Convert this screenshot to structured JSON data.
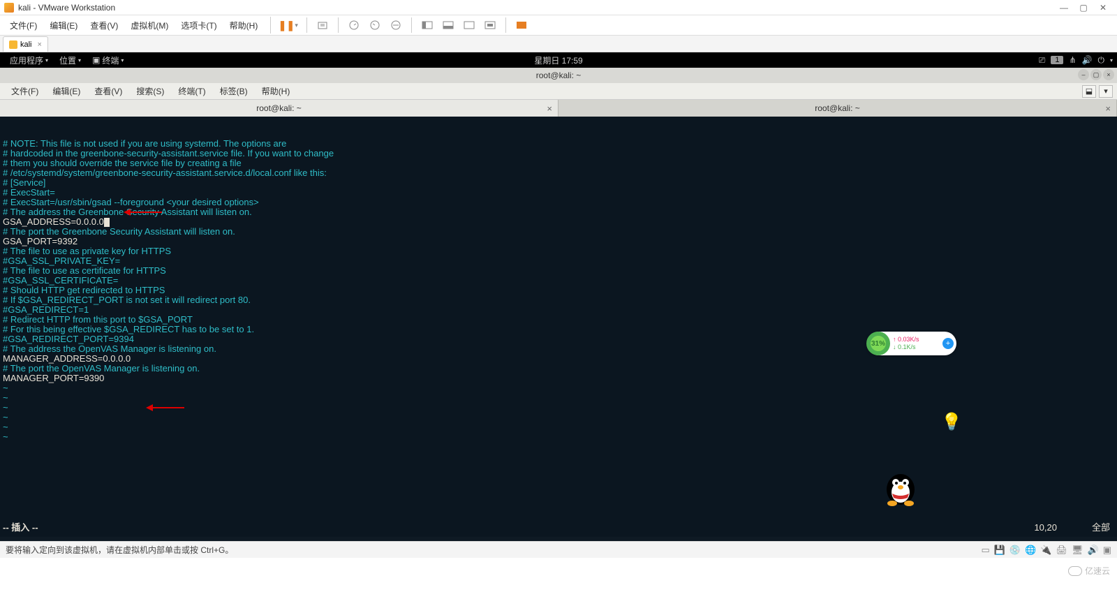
{
  "vmware": {
    "title": "kali - VMware Workstation",
    "menu": [
      "文件(F)",
      "编辑(E)",
      "查看(V)",
      "虚拟机(M)",
      "选项卡(T)",
      "帮助(H)"
    ],
    "guest_tab": "kali",
    "status_hint": "要将输入定向到该虚拟机，请在虚拟机内部单击或按 Ctrl+G。"
  },
  "kali_panel": {
    "apps": "应用程序",
    "places": "位置",
    "terminal": "终端",
    "clock": "星期日 17:59",
    "workspace": "1"
  },
  "terminal": {
    "title": "root@kali: ~",
    "menu": [
      "文件(F)",
      "编辑(E)",
      "查看(V)",
      "搜索(S)",
      "终端(T)",
      "标签(B)",
      "帮助(H)"
    ],
    "tabs": [
      "root@kali: ~",
      "root@kali: ~"
    ],
    "lines": [
      {
        "c": "c",
        "t": "# NOTE: This file is not used if you are using systemd. The options are"
      },
      {
        "c": "c",
        "t": "# hardcoded in the greenbone-security-assistant.service file. If you want to change"
      },
      {
        "c": "c",
        "t": "# them you should override the service file by creating a file"
      },
      {
        "c": "c",
        "t": "# /etc/systemd/system/greenbone-security-assistant.service.d/local.conf like this:"
      },
      {
        "c": "c",
        "t": "# [Service]"
      },
      {
        "c": "c",
        "t": "# ExecStart="
      },
      {
        "c": "c",
        "t": "# ExecStart=/usr/sbin/gsad --foreground <your desired options>"
      },
      {
        "c": "b",
        "t": ""
      },
      {
        "c": "c",
        "t": "# The address the Greenbone Security Assistant will listen on."
      },
      {
        "c": "w",
        "t": "GSA_ADDRESS=0.0.0.0",
        "cursor": true,
        "arrow": true
      },
      {
        "c": "b",
        "t": ""
      },
      {
        "c": "c",
        "t": "# The port the Greenbone Security Assistant will listen on."
      },
      {
        "c": "w",
        "t": "GSA_PORT=9392"
      },
      {
        "c": "b",
        "t": ""
      },
      {
        "c": "c",
        "t": "# The file to use as private key for HTTPS"
      },
      {
        "c": "c",
        "t": "#GSA_SSL_PRIVATE_KEY="
      },
      {
        "c": "b",
        "t": ""
      },
      {
        "c": "c",
        "t": "# The file to use as certificate for HTTPS"
      },
      {
        "c": "c",
        "t": "#GSA_SSL_CERTIFICATE="
      },
      {
        "c": "b",
        "t": ""
      },
      {
        "c": "c",
        "t": "# Should HTTP get redirected to HTTPS"
      },
      {
        "c": "c",
        "t": "# If $GSA_REDIRECT_PORT is not set it will redirect port 80."
      },
      {
        "c": "c",
        "t": "#GSA_REDIRECT=1"
      },
      {
        "c": "b",
        "t": ""
      },
      {
        "c": "c",
        "t": "# Redirect HTTP from this port to $GSA_PORT"
      },
      {
        "c": "c",
        "t": "# For this being effective $GSA_REDIRECT has to be set to 1."
      },
      {
        "c": "c",
        "t": "#GSA_REDIRECT_PORT=9394"
      },
      {
        "c": "b",
        "t": ""
      },
      {
        "c": "c",
        "t": "# The address the OpenVAS Manager is listening on."
      },
      {
        "c": "w",
        "t": "MANAGER_ADDRESS=0.0.0.0",
        "arrow": true
      },
      {
        "c": "b",
        "t": ""
      },
      {
        "c": "c",
        "t": "# The port the OpenVAS Manager is listening on."
      },
      {
        "c": "w",
        "t": "MANAGER_PORT=9390"
      }
    ],
    "vim_mode": "-- 插入 --",
    "vim_pos": "10,20",
    "vim_scroll": "全部"
  },
  "widget": {
    "pct": "31%",
    "up": "0.03K/s",
    "down": "0.1K/s"
  },
  "watermark": "亿速云"
}
